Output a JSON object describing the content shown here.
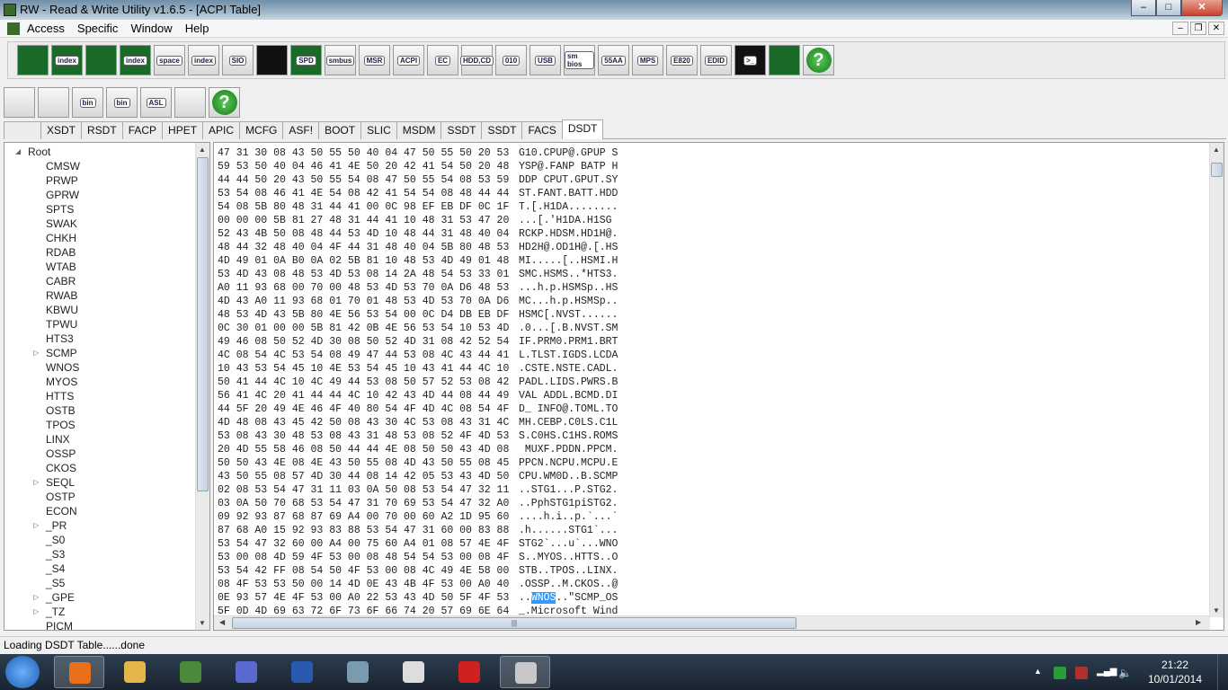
{
  "window": {
    "title": "RW - Read & Write Utility v1.6.5 - [ACPI Table]",
    "minimize": "–",
    "maximize": "□",
    "close": "✕"
  },
  "menu": [
    "Access",
    "Specific",
    "Window",
    "Help"
  ],
  "mdi": {
    "minimize": "–",
    "restore": "❐",
    "close": "✕"
  },
  "toolbar1": [
    {
      "name": "pci",
      "label": ""
    },
    {
      "name": "pci-index",
      "label": "index"
    },
    {
      "name": "memory",
      "label": ""
    },
    {
      "name": "memory-index",
      "label": "index"
    },
    {
      "name": "io-space",
      "label": "space"
    },
    {
      "name": "io-index",
      "label": "index"
    },
    {
      "name": "sio",
      "label": "SIO"
    },
    {
      "name": "oscilloscope",
      "label": ""
    },
    {
      "name": "spd",
      "label": "SPD"
    },
    {
      "name": "smbus",
      "label": "smbus"
    },
    {
      "name": "msr",
      "label": "MSR"
    },
    {
      "name": "acpi",
      "label": "ACPI"
    },
    {
      "name": "ec",
      "label": "EC"
    },
    {
      "name": "hdd-cd",
      "label": "HDD,CD"
    },
    {
      "name": "disk-010",
      "label": "010"
    },
    {
      "name": "usb",
      "label": "USB"
    },
    {
      "name": "smbios",
      "label": "sm bios"
    },
    {
      "name": "55aa",
      "label": "55AA"
    },
    {
      "name": "mps",
      "label": "MPS"
    },
    {
      "name": "e820",
      "label": "E820"
    },
    {
      "name": "edid",
      "label": "EDID"
    },
    {
      "name": "command",
      "label": ">_"
    },
    {
      "name": "device",
      "label": ""
    },
    {
      "name": "help",
      "label": "?"
    }
  ],
  "toolbar2": [
    {
      "name": "save",
      "label": ""
    },
    {
      "name": "save-all",
      "label": ""
    },
    {
      "name": "save-bin",
      "label": "bin"
    },
    {
      "name": "save-all-bin",
      "label": "bin"
    },
    {
      "name": "asl",
      "label": "ASL"
    },
    {
      "name": "find",
      "label": ""
    },
    {
      "name": "help",
      "label": "?"
    }
  ],
  "tabs": [
    "",
    "XSDT",
    "RSDT",
    "FACP",
    "HPET",
    "APIC",
    "MCFG",
    "ASF!",
    "BOOT",
    "SLIC",
    "MSDM",
    "SSDT",
    "SSDT",
    "FACS",
    "DSDT"
  ],
  "active_tab": "DSDT",
  "tree": {
    "root": "Root",
    "items": [
      {
        "label": "CMSW"
      },
      {
        "label": "PRWP"
      },
      {
        "label": "GPRW"
      },
      {
        "label": "SPTS"
      },
      {
        "label": "SWAK"
      },
      {
        "label": "CHKH"
      },
      {
        "label": "RDAB"
      },
      {
        "label": "WTAB"
      },
      {
        "label": "CABR"
      },
      {
        "label": "RWAB"
      },
      {
        "label": "KBWU"
      },
      {
        "label": "TPWU"
      },
      {
        "label": "HTS3"
      },
      {
        "label": "SCMP",
        "expandable": true
      },
      {
        "label": "WNOS"
      },
      {
        "label": "MYOS"
      },
      {
        "label": "HTTS"
      },
      {
        "label": "OSTB"
      },
      {
        "label": "TPOS"
      },
      {
        "label": "LINX"
      },
      {
        "label": "OSSP"
      },
      {
        "label": "CKOS"
      },
      {
        "label": "SEQL",
        "expandable": true
      },
      {
        "label": "OSTP"
      },
      {
        "label": "ECON"
      },
      {
        "label": "_PR",
        "expandable": true
      },
      {
        "label": "_S0"
      },
      {
        "label": "_S3"
      },
      {
        "label": "_S4"
      },
      {
        "label": "_S5"
      },
      {
        "label": "_GPE",
        "expandable": true
      },
      {
        "label": "_TZ",
        "expandable": true
      },
      {
        "label": "PICM"
      }
    ]
  },
  "hex_rows": [
    {
      "hex": "47 31 30 08 43 50 55 50 40 04 47 50 55 50 20 53",
      "ascii": "G10.CPUP@.GPUP S"
    },
    {
      "hex": "59 53 50 40 04 46 41 4E 50 20 42 41 54 50 20 48",
      "ascii": "YSP@.FANP BATP H"
    },
    {
      "hex": "44 44 50 20 43 50 55 54 08 47 50 55 54 08 53 59",
      "ascii": "DDP CPUT.GPUT.SY"
    },
    {
      "hex": "53 54 08 46 41 4E 54 08 42 41 54 54 08 48 44 44",
      "ascii": "ST.FANT.BATT.HDD"
    },
    {
      "hex": "54 08 5B 80 48 31 44 41 00 0C 98 EF EB DF 0C 1F",
      "ascii": "T.[.H1DA........"
    },
    {
      "hex": "00 00 00 5B 81 27 48 31 44 41 10 48 31 53 47 20",
      "ascii": "...[.'H1DA.H1SG "
    },
    {
      "hex": "52 43 4B 50 08 48 44 53 4D 10 48 44 31 48 40 04",
      "ascii": "RCKP.HDSM.HD1H@."
    },
    {
      "hex": "48 44 32 48 40 04 4F 44 31 48 40 04 5B 80 48 53",
      "ascii": "HD2H@.OD1H@.[.HS"
    },
    {
      "hex": "4D 49 01 0A B0 0A 02 5B 81 10 48 53 4D 49 01 48",
      "ascii": "MI.....[..HSMI.H"
    },
    {
      "hex": "53 4D 43 08 48 53 4D 53 08 14 2A 48 54 53 33 01",
      "ascii": "SMC.HSMS..*HTS3."
    },
    {
      "hex": "A0 11 93 68 00 70 00 48 53 4D 53 70 0A D6 48 53",
      "ascii": "...h.p.HSMSp..HS"
    },
    {
      "hex": "4D 43 A0 11 93 68 01 70 01 48 53 4D 53 70 0A D6",
      "ascii": "MC...h.p.HSMSp.."
    },
    {
      "hex": "48 53 4D 43 5B 80 4E 56 53 54 00 0C D4 DB EB DF",
      "ascii": "HSMC[.NVST......"
    },
    {
      "hex": "0C 30 01 00 00 5B 81 42 0B 4E 56 53 54 10 53 4D",
      "ascii": ".0...[.B.NVST.SM"
    },
    {
      "hex": "49 46 08 50 52 4D 30 08 50 52 4D 31 08 42 52 54",
      "ascii": "IF.PRM0.PRM1.BRT"
    },
    {
      "hex": "4C 08 54 4C 53 54 08 49 47 44 53 08 4C 43 44 41",
      "ascii": "L.TLST.IGDS.LCDA"
    },
    {
      "hex": "10 43 53 54 45 10 4E 53 54 45 10 43 41 44 4C 10",
      "ascii": ".CSTE.NSTE.CADL."
    },
    {
      "hex": "50 41 44 4C 10 4C 49 44 53 08 50 57 52 53 08 42",
      "ascii": "PADL.LIDS.PWRS.B"
    },
    {
      "hex": "56 41 4C 20 41 44 44 4C 10 42 43 4D 44 08 44 49",
      "ascii": "VAL ADDL.BCMD.DI"
    },
    {
      "hex": "44 5F 20 49 4E 46 4F 40 80 54 4F 4D 4C 08 54 4F",
      "ascii": "D_ INFO@.TOML.TO"
    },
    {
      "hex": "4D 48 08 43 45 42 50 08 43 30 4C 53 08 43 31 4C",
      "ascii": "MH.CEBP.C0LS.C1L"
    },
    {
      "hex": "53 08 43 30 48 53 08 43 31 48 53 08 52 4F 4D 53",
      "ascii": "S.C0HS.C1HS.ROMS"
    },
    {
      "hex": "20 4D 55 58 46 08 50 44 44 4E 08 50 50 43 4D 08",
      "ascii": " MUXF.PDDN.PPCM."
    },
    {
      "hex": "50 50 43 4E 08 4E 43 50 55 08 4D 43 50 55 08 45",
      "ascii": "PPCN.NCPU.MCPU.E"
    },
    {
      "hex": "43 50 55 08 57 4D 30 44 08 14 42 05 53 43 4D 50",
      "ascii": "CPU.WM0D..B.SCMP"
    },
    {
      "hex": "02 08 53 54 47 31 11 03 0A 50 08 53 54 47 32 11",
      "ascii": "..STG1...P.STG2."
    },
    {
      "hex": "03 0A 50 70 68 53 54 47 31 70 69 53 54 47 32 A0",
      "ascii": "..PphSTG1piSTG2."
    },
    {
      "hex": "09 92 93 87 68 87 69 A4 00 70 00 60 A2 1D 95 60",
      "ascii": "....h.i..p.`...`"
    },
    {
      "hex": "87 68 A0 15 92 93 83 88 53 54 47 31 60 00 83 88",
      "ascii": ".h......STG1`..."
    },
    {
      "hex": "53 54 47 32 60 00 A4 00 75 60 A4 01 08 57 4E 4F",
      "ascii": "STG2`...u`...WNO"
    },
    {
      "hex": "53 00 08 4D 59 4F 53 00 08 48 54 54 53 00 08 4F",
      "ascii": "S..MYOS..HTTS..O"
    },
    {
      "hex": "53 54 42 FF 08 54 50 4F 53 00 08 4C 49 4E 58 00",
      "ascii": "STB..TPOS..LINX."
    },
    {
      "hex": "08 4F 53 53 50 00 14 4D 0E 43 4B 4F 53 00 A0 40",
      "ascii": ".OSSP..M.CKOS..@"
    },
    {
      "hex": "0E 93 57 4E 4F 53 00 A0 22 53 43 4D 50 5F 4F 53",
      "ascii": "..WNOS..\"SCMP_OS",
      "ascii_pre": "..",
      "ascii_sel": "WNOS",
      "ascii_post": "..\"SCMP_OS"
    },
    {
      "hex": "5F 0D 4D 69 63 72 6F 73 6F 66 74 20 57 69 6E 64",
      "ascii": "_.Microsoft Wind"
    }
  ],
  "status": "Loading DSDT Table......done",
  "taskbar": {
    "apps": [
      "firefox",
      "file-explorer",
      "rw-utility",
      "visual-studio-infinity",
      "visual-studio",
      "scanner",
      "portrait",
      "paint-splash",
      "rw-active"
    ],
    "time": "21:22",
    "date": "10/01/2014"
  }
}
